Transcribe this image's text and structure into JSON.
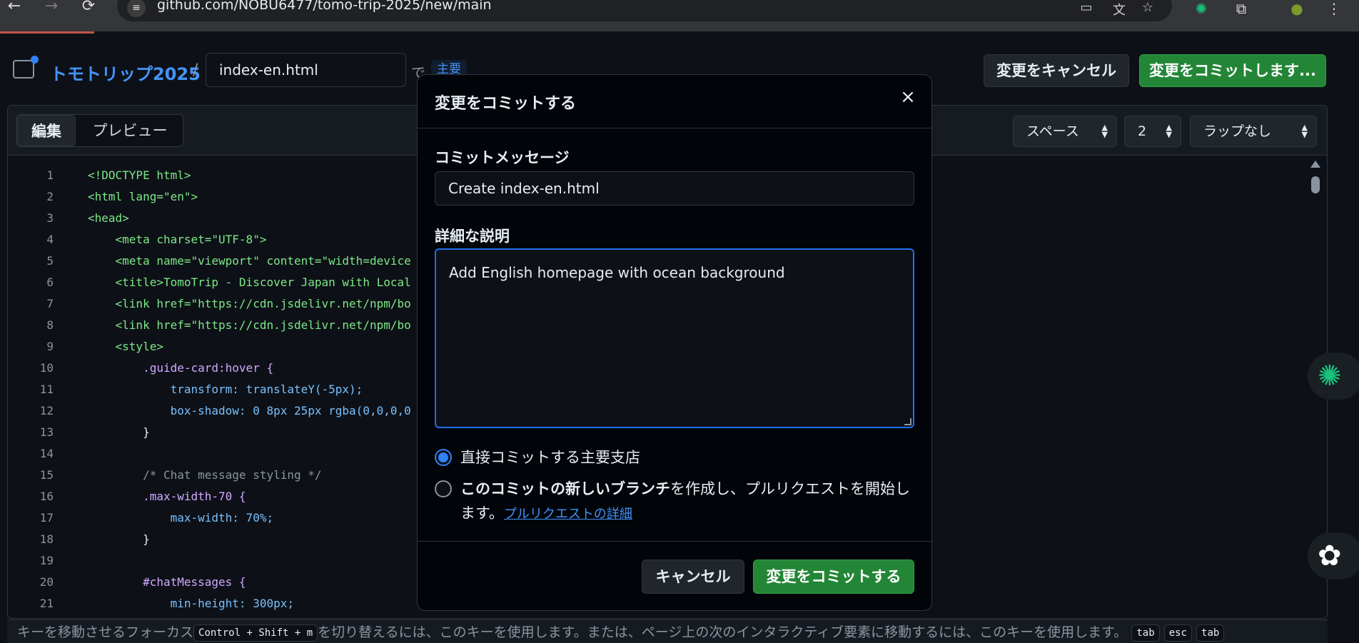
{
  "browser": {
    "url": "github.com/NOBU6477/tomo-trip-2025/new/main",
    "back_icon": "←",
    "forward_icon": "→",
    "reload_icon": "⟳"
  },
  "header": {
    "repo_name": "トモトリップ2025",
    "separator": "/",
    "filename": "index-en.html",
    "in_label": "で",
    "branch_badge": "主要",
    "cancel_changes": "変更をキャンセル",
    "commit_changes": "変更をコミットします..."
  },
  "editor": {
    "tab_edit": "編集",
    "tab_preview": "プレビュー",
    "indent_mode": "スペース",
    "indent_size": "2",
    "wrap_mode": "ラップなし",
    "lines": [
      {
        "n": "1",
        "text": "<!DOCTYPE html>"
      },
      {
        "n": "2",
        "text": "<html lang=\"en\">"
      },
      {
        "n": "3",
        "text": "<head>"
      },
      {
        "n": "4",
        "text": "    <meta charset=\"UTF-8\">"
      },
      {
        "n": "5",
        "text": "    <meta name=\"viewport\" content=\"width=device"
      },
      {
        "n": "6",
        "text": "    <title>TomoTrip - Discover Japan with Local"
      },
      {
        "n": "7",
        "text": "    <link href=\"https://cdn.jsdelivr.net/npm/bo"
      },
      {
        "n": "8",
        "text": "    <link href=\"https://cdn.jsdelivr.net/npm/bo"
      },
      {
        "n": "9",
        "text": "    <style>"
      },
      {
        "n": "10",
        "text": "        .guide-card:hover {"
      },
      {
        "n": "11",
        "text": "            transform: translateY(-5px);"
      },
      {
        "n": "12",
        "text": "            box-shadow: 0 8px 25px rgba(0,0,0,0"
      },
      {
        "n": "13",
        "text": "        }"
      },
      {
        "n": "14",
        "text": ""
      },
      {
        "n": "15",
        "text": "        /* Chat message styling */"
      },
      {
        "n": "16",
        "text": "        .max-width-70 {"
      },
      {
        "n": "17",
        "text": "            max-width: 70%;"
      },
      {
        "n": "18",
        "text": "        }"
      },
      {
        "n": "19",
        "text": ""
      },
      {
        "n": "20",
        "text": "        #chatMessages {"
      },
      {
        "n": "21",
        "text": "            min-height: 300px;"
      }
    ]
  },
  "footer": {
    "hint_before": "キーを移動させるフォーカス",
    "kbd_shortcut": "Control + Shift + m",
    "hint_after": "を切り替えるには、このキーを使用します。または、ページ上の次のインタラクティブ要素に移動するには、このキーを使用します。",
    "kbd_tab1": "tab",
    "kbd_esc": "esc",
    "kbd_tab2": "tab"
  },
  "modal": {
    "title": "変更をコミットする",
    "close_icon": "×",
    "message_label": "コミットメッセージ",
    "message_value": "Create index-en.html",
    "description_label": "詳細な説明",
    "description_value": "Add English homepage with ocean background",
    "option_direct": "直接コミットする主要支店",
    "option_branch_bold": "このコミットの新しいブランチ",
    "option_branch_rest": "を作成し、プルリクエストを開始します。",
    "option_branch_link": "プルリクエストの詳細",
    "cancel_button": "キャンセル",
    "commit_button": "変更をコミットする"
  },
  "colors": {
    "accent": "#2f81f7",
    "primary_button": "#238636",
    "background": "#0d1117"
  }
}
